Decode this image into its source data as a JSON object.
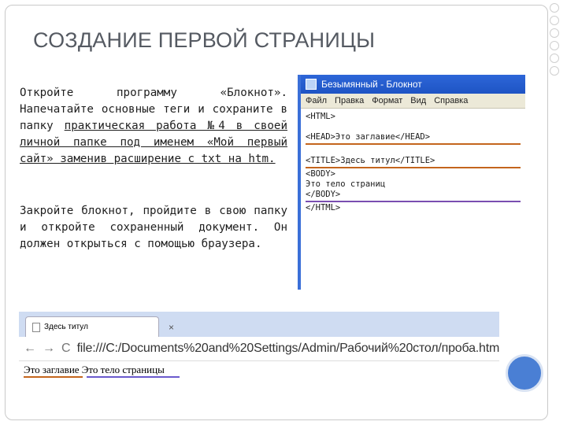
{
  "title": "СОЗДАНИЕ ПЕРВОЙ СТРАНИЦЫ",
  "para1": {
    "t1": "Откройте программу «Блокнот». Напечатайте основные теги и сохраните в папку ",
    "u1": "практическая работа №4 в своей личной папке под именем «Мой первый сайт» заменив расширение с txt на htm."
  },
  "para2": "Закройте блокнот, пройдите в свою папку и откройте сохраненный документ. Он должен открыться с помощью браузера.",
  "notepad": {
    "title": "Безымянный - Блокнот",
    "menu": [
      "Файл",
      "Правка",
      "Формат",
      "Вид",
      "Справка"
    ],
    "lines": {
      "l1": "<HTML>",
      "l2": "<HEAD>Это заглавие</HEAD>",
      "l3": "<TITLE>Здесь титул</TITLE>",
      "l4": "<BODY>",
      "l5": "Это тело страниц",
      "l6": "</BODY>",
      "l7": "</HTML>"
    }
  },
  "browser": {
    "tab_title": "Здесь титул",
    "tab_close": "×",
    "back": "←",
    "forward": "→",
    "reload": "C",
    "url": "file:///C:/Documents%20and%20Settings/Admin/Рабочий%20стол/проба.htm",
    "page_text": "Это заглавие Это тело страницы"
  }
}
